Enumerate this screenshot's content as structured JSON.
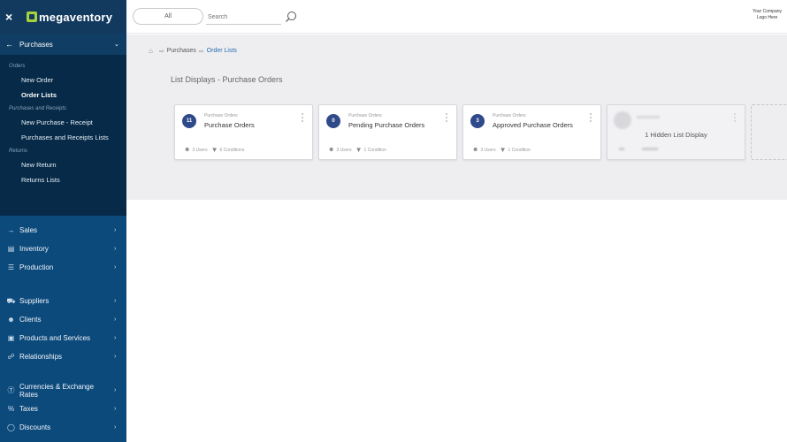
{
  "app": {
    "logo_text": "megaventory",
    "close_icon": "×"
  },
  "sidebar": {
    "back_section": {
      "label": "Purchases"
    },
    "submenu": [
      {
        "type": "head",
        "label": "Orders"
      },
      {
        "type": "item",
        "label": "New Order",
        "active": false
      },
      {
        "type": "item",
        "label": "Order Lists",
        "active": true
      },
      {
        "type": "head",
        "label": "Purchases and Receipts"
      },
      {
        "type": "item",
        "label": "New Purchase - Receipt",
        "active": false
      },
      {
        "type": "item",
        "label": "Purchases and Receipts Lists",
        "active": false
      },
      {
        "type": "head",
        "label": "Returns"
      },
      {
        "type": "item",
        "label": "New Return",
        "active": false
      },
      {
        "type": "item",
        "label": "Returns Lists",
        "active": false
      }
    ],
    "items": [
      {
        "label": "Sales",
        "icon": "arrow-right-icon"
      },
      {
        "label": "Inventory",
        "icon": "warehouse-icon"
      },
      {
        "label": "Production",
        "icon": "production-icon"
      },
      {
        "label": "Suppliers",
        "icon": "truck-icon"
      },
      {
        "label": "Clients",
        "icon": "clients-icon"
      },
      {
        "label": "Products and Services",
        "icon": "box-icon"
      },
      {
        "label": "Relationships",
        "icon": "relationships-icon"
      },
      {
        "label": "Currencies & Exchange Rates",
        "icon": "currency-icon"
      },
      {
        "label": "Taxes",
        "icon": "percent-icon"
      },
      {
        "label": "Discounts",
        "icon": "tag-icon"
      }
    ]
  },
  "topbar": {
    "scope_label": "All",
    "search_placeholder": "Search",
    "company_line1": "Your Company",
    "company_line2": "Logo Here"
  },
  "breadcrumb": {
    "parent": "Purchases",
    "current": "Order Lists"
  },
  "page": {
    "title": "List Displays - Purchase Orders"
  },
  "cards": [
    {
      "count": "11",
      "category": "Purchase Orders",
      "name": "Purchase Orders",
      "users": "3 Users",
      "conditions": "6 Conditions"
    },
    {
      "count": "0",
      "category": "Purchase Orders",
      "name": "Pending Purchase Orders",
      "users": "3 Users",
      "conditions": "1 Condition"
    },
    {
      "count": "3",
      "category": "Purchase Orders",
      "name": "Approved Purchase Orders",
      "users": "3 Users",
      "conditions": "1 Condition"
    }
  ],
  "hidden_card": {
    "label": "1 Hidden List Display"
  },
  "colors": {
    "sidebar_bg": "#0d4a7c",
    "submenu_bg": "#062a47",
    "badge": "#2f4a8a",
    "accent_link": "#2b6cb0",
    "logo_green": "#a7d23a"
  }
}
